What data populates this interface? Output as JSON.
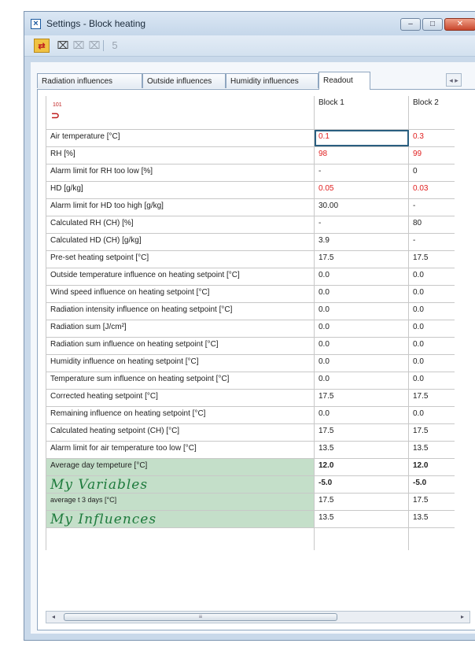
{
  "window": {
    "title": "Settings - Block heating",
    "icon": "x-box-icon",
    "controls": {
      "minimize": "–",
      "maximize": "□",
      "close": "✕"
    }
  },
  "toolbar": {
    "save_icon": "save-icon",
    "save_glyph": "⇄",
    "tool1_glyph": "⌧",
    "tool2_glyph": "⌧",
    "tool3_glyph": "⌧",
    "tool4_glyph": "5"
  },
  "tabs": [
    {
      "label": "Radiation influences"
    },
    {
      "label": "Outside influences"
    },
    {
      "label": "Humidity influences"
    },
    {
      "label": "Readout"
    }
  ],
  "tab_scroll": "◂ ▸",
  "table": {
    "header_icon_number": "101",
    "columns": [
      "Block 1",
      "Block 2"
    ],
    "rows": [
      {
        "label": "Air temperature [°C]",
        "b1": "0.1",
        "b2": "0.3"
      },
      {
        "label": "RH [%]",
        "b1": "98",
        "b2": "99"
      },
      {
        "label": "Alarm limit for RH too low [%]",
        "b1": "-",
        "b2": "0"
      },
      {
        "label": "HD [g/kg]",
        "b1": "0.05",
        "b2": "0.03"
      },
      {
        "label": "Alarm limit for HD too high [g/kg]",
        "b1": "30.00",
        "b2": "-"
      },
      {
        "label": "Calculated RH (CH) [%]",
        "b1": "-",
        "b2": "80"
      },
      {
        "label": "Calculated HD (CH) [g/kg]",
        "b1": "3.9",
        "b2": "-"
      },
      {
        "label": "Pre-set heating setpoint [°C]",
        "b1": "17.5",
        "b2": "17.5"
      },
      {
        "label": "Outside temperature influence on heating setpoint [°C]",
        "b1": "0.0",
        "b2": "0.0"
      },
      {
        "label": "Wind speed influence on heating setpoint [°C]",
        "b1": "0.0",
        "b2": "0.0"
      },
      {
        "label": "Radiation intensity influence on heating setpoint [°C]",
        "b1": "0.0",
        "b2": "0.0"
      },
      {
        "label": "Radiation sum [J/cm²]",
        "b1": "0.0",
        "b2": "0.0"
      },
      {
        "label": "Radiation sum influence on heating setpoint [°C]",
        "b1": "0.0",
        "b2": "0.0"
      },
      {
        "label": "Humidity influence on heating setpoint [°C]",
        "b1": "0.0",
        "b2": "0.0"
      },
      {
        "label": "Temperature sum influence on heating setpoint [°C]",
        "b1": "0.0",
        "b2": "0.0"
      },
      {
        "label": "Corrected heating setpoint [°C]",
        "b1": "17.5",
        "b2": "17.5"
      },
      {
        "label": "Remaining influence on heating setpoint [°C]",
        "b1": "0.0",
        "b2": "0.0"
      },
      {
        "label": "Calculated heating setpoint (CH) [°C]",
        "b1": "17.5",
        "b2": "17.5"
      },
      {
        "label": "Alarm limit for air temperature too low [°C]",
        "b1": "13.5",
        "b2": "13.5"
      },
      {
        "label": "Average day tempeture [°C]",
        "b1": "12.0",
        "b2": "12.0"
      },
      {
        "label": "My Variables",
        "b1": "-5.0",
        "b2": "-5.0"
      },
      {
        "label": "average t 3 days [°C]",
        "b1": "17.5",
        "b2": "17.5"
      },
      {
        "label": "My Influences",
        "b1": "13.5",
        "b2": "13.5"
      }
    ]
  },
  "scrollbar": {
    "left": "◂",
    "right": "▸",
    "grip": "≡"
  },
  "colors": {
    "alarm_red": "#e02020",
    "custom_green": "#c4dfc9",
    "handwriting_green": "#1d7a3c"
  }
}
